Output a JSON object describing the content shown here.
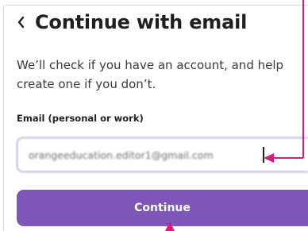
{
  "screen": {
    "title": "Continue with email",
    "back_icon": "chevron-left-icon",
    "subtitle": "We’ll check if you have an account, and help create one if you don’t.",
    "email_field": {
      "label": "Email (personal or work)",
      "value": "orangeeducation.editor1@gmail.com"
    },
    "continue_label": "Continue"
  },
  "colors": {
    "accent": "#7d56b8",
    "input_border": "#8a6bc2",
    "annotation": "#d61f7a"
  }
}
